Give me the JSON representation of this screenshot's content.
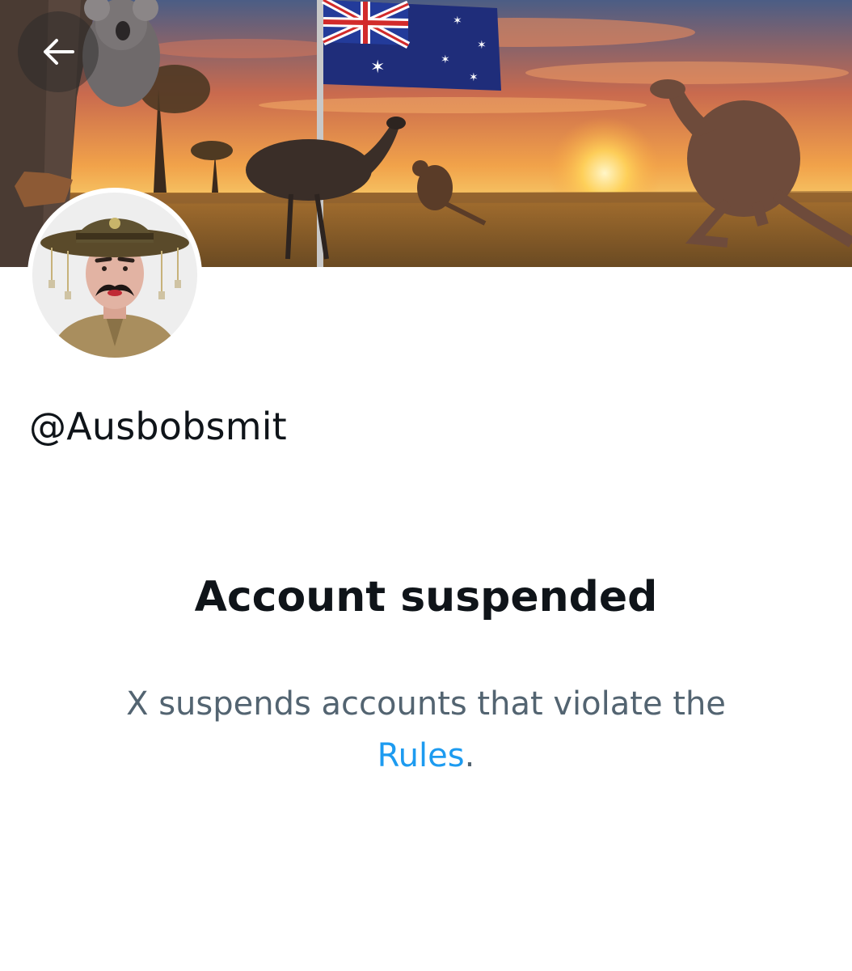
{
  "profile": {
    "handle": "@Ausbobsmit"
  },
  "suspension": {
    "title": "Account suspended",
    "body_before_link": "X suspends accounts that violate the ",
    "link_text": "Rules",
    "body_after_link": "."
  },
  "icons": {
    "back": "arrow-left-icon"
  },
  "colors": {
    "text_primary": "#0f1419",
    "text_secondary": "#536471",
    "link": "#1d9bf0"
  }
}
